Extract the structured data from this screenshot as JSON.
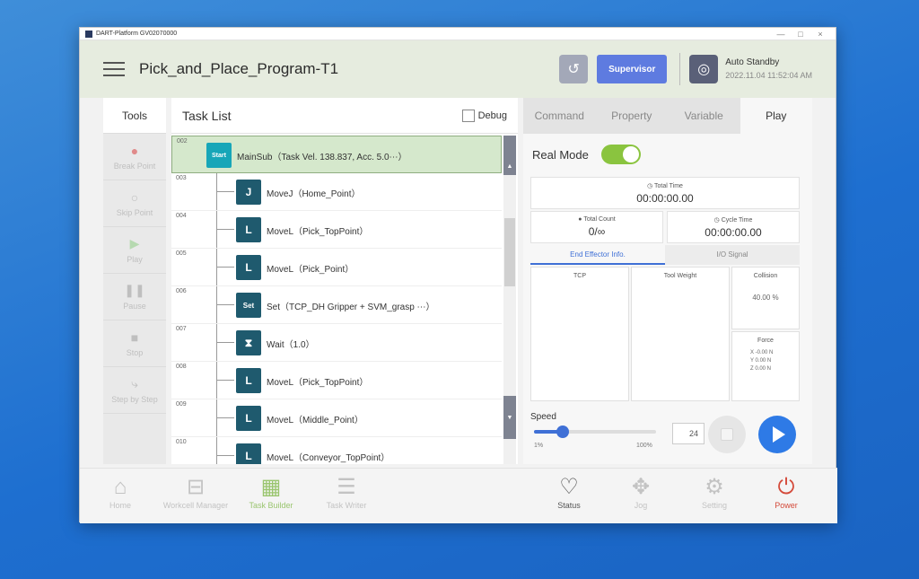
{
  "window": {
    "title": "DART-Platform GV02070000",
    "controls": [
      "—",
      "□",
      "×"
    ]
  },
  "header": {
    "program_name": "Pick_and_Place_Program-T1",
    "supervisor_label": "Supervisor",
    "status_label": "Auto Standby",
    "timestamp": "2022.11.04 11:52:04 AM"
  },
  "tools": {
    "title": "Tools",
    "items": [
      {
        "label": "Break Point",
        "icon": "●"
      },
      {
        "label": "Skip Point",
        "icon": "○"
      },
      {
        "label": "Play",
        "icon": "▶"
      },
      {
        "label": "Pause",
        "icon": "❚❚"
      },
      {
        "label": "Stop",
        "icon": "■"
      },
      {
        "label": "Step by Step",
        "icon": "⤷"
      }
    ]
  },
  "tasklist": {
    "title": "Task List",
    "debug_label": "Debug",
    "rows": [
      {
        "num": "002",
        "icon": "Start",
        "text": "MainSub（Task Vel. 138.837, Acc. 5.0⋯）"
      },
      {
        "num": "003",
        "icon": "J",
        "text": "MoveJ（Home_Point）"
      },
      {
        "num": "004",
        "icon": "L",
        "text": "MoveL（Pick_TopPoint）"
      },
      {
        "num": "005",
        "icon": "L",
        "text": "MoveL（Pick_Point）"
      },
      {
        "num": "006",
        "icon": "Set",
        "text": "Set（TCP_DH Gripper + SVM_grasp ⋯）"
      },
      {
        "num": "007",
        "icon": "⧗",
        "text": "Wait（1.0）"
      },
      {
        "num": "008",
        "icon": "L",
        "text": "MoveL（Pick_TopPoint）"
      },
      {
        "num": "009",
        "icon": "L",
        "text": "MoveL（Middle_Point）"
      },
      {
        "num": "010",
        "icon": "L",
        "text": "MoveL（Conveyor_TopPoint）"
      }
    ]
  },
  "rightpanel": {
    "tabs": [
      "Command",
      "Property",
      "Variable",
      "Play"
    ],
    "active_tab": "Play",
    "real_mode_label": "Real Mode",
    "real_mode_on": true,
    "total_time_label": "Total Time",
    "total_time": "00:00:00.00",
    "total_count_label": "Total Count",
    "total_count": "0/∞",
    "cycle_time_label": "Cycle Time",
    "cycle_time": "00:00:00.00",
    "ee_tabs": [
      "End Effector Info.",
      "I/O Signal"
    ],
    "tcp_label": "TCP",
    "tool_weight_label": "Tool Weight",
    "collision_label": "Collision",
    "collision_value": "40.00 %",
    "force_label": "Force",
    "force_x": "X  -0.00 N",
    "force_y": "Y  0.00 N",
    "force_z": "Z  0.00 N",
    "speed_label": "Speed",
    "speed_min": "1%",
    "speed_max": "100%",
    "speed_value": "24"
  },
  "bottombar": {
    "items": [
      {
        "label": "Home",
        "icon": "⌂"
      },
      {
        "label": "Workcell Manager",
        "icon": "⊟"
      },
      {
        "label": "Task Builder",
        "icon": "▦"
      },
      {
        "label": "Task Writer",
        "icon": "☰"
      },
      {
        "label": "Status",
        "icon": "♡"
      },
      {
        "label": "Jog",
        "icon": "✥"
      },
      {
        "label": "Setting",
        "icon": "⚙"
      },
      {
        "label": "Power",
        "icon": "⏻"
      }
    ]
  },
  "colors": {
    "accent": "#2e7ae6",
    "toggle_on": "#8ac43f",
    "start_row_bg": "#d5e8cc",
    "power": "#d44a3a",
    "command_icon_bg": "#1f5a6e"
  }
}
